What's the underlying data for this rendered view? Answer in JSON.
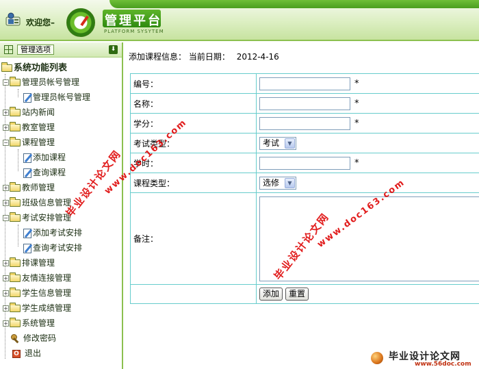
{
  "header": {
    "welcome": "欢迎您–",
    "title": "管理平台",
    "subtitle": "PLATFORM SYSYTEM"
  },
  "sidebar": {
    "panel_title": "管理选项",
    "tree_title": "系统功能列表",
    "items": [
      {
        "label": "管理员帐号管理"
      },
      {
        "label": "管理员帐号管理"
      },
      {
        "label": "站内新闻"
      },
      {
        "label": "教室管理"
      },
      {
        "label": "课程管理"
      },
      {
        "label": "添加课程"
      },
      {
        "label": "查询课程"
      },
      {
        "label": "教师管理"
      },
      {
        "label": "班级信息管理"
      },
      {
        "label": "考试安排管理"
      },
      {
        "label": "添加考试安排"
      },
      {
        "label": "查询考试安排"
      },
      {
        "label": "排课管理"
      },
      {
        "label": "友情连接管理"
      },
      {
        "label": "学生信息管理"
      },
      {
        "label": "学生成绩管理"
      },
      {
        "label": "系统管理"
      },
      {
        "label": "修改密码"
      },
      {
        "label": "退出"
      }
    ]
  },
  "main": {
    "heading": "添加课程信息：",
    "date_label": "当前日期：",
    "date_value": "2012-4-16",
    "fields": {
      "number_label": "编号：",
      "name_label": "名称：",
      "credit_label": "学分：",
      "exam_type_label": "考试类型：",
      "exam_type_value": "考试",
      "hours_label": "学时：",
      "course_type_label": "课程类型：",
      "course_type_value": "选修",
      "remark_label": "备注：",
      "required_mark": "*"
    },
    "buttons": {
      "add": "添加",
      "reset": "重置"
    }
  },
  "watermarks": {
    "site_cn": "毕业设计论文网",
    "site_url": "www.doc163.com",
    "footer_cn": "毕业设计论文网",
    "footer_url": "www.56doc.com"
  }
}
